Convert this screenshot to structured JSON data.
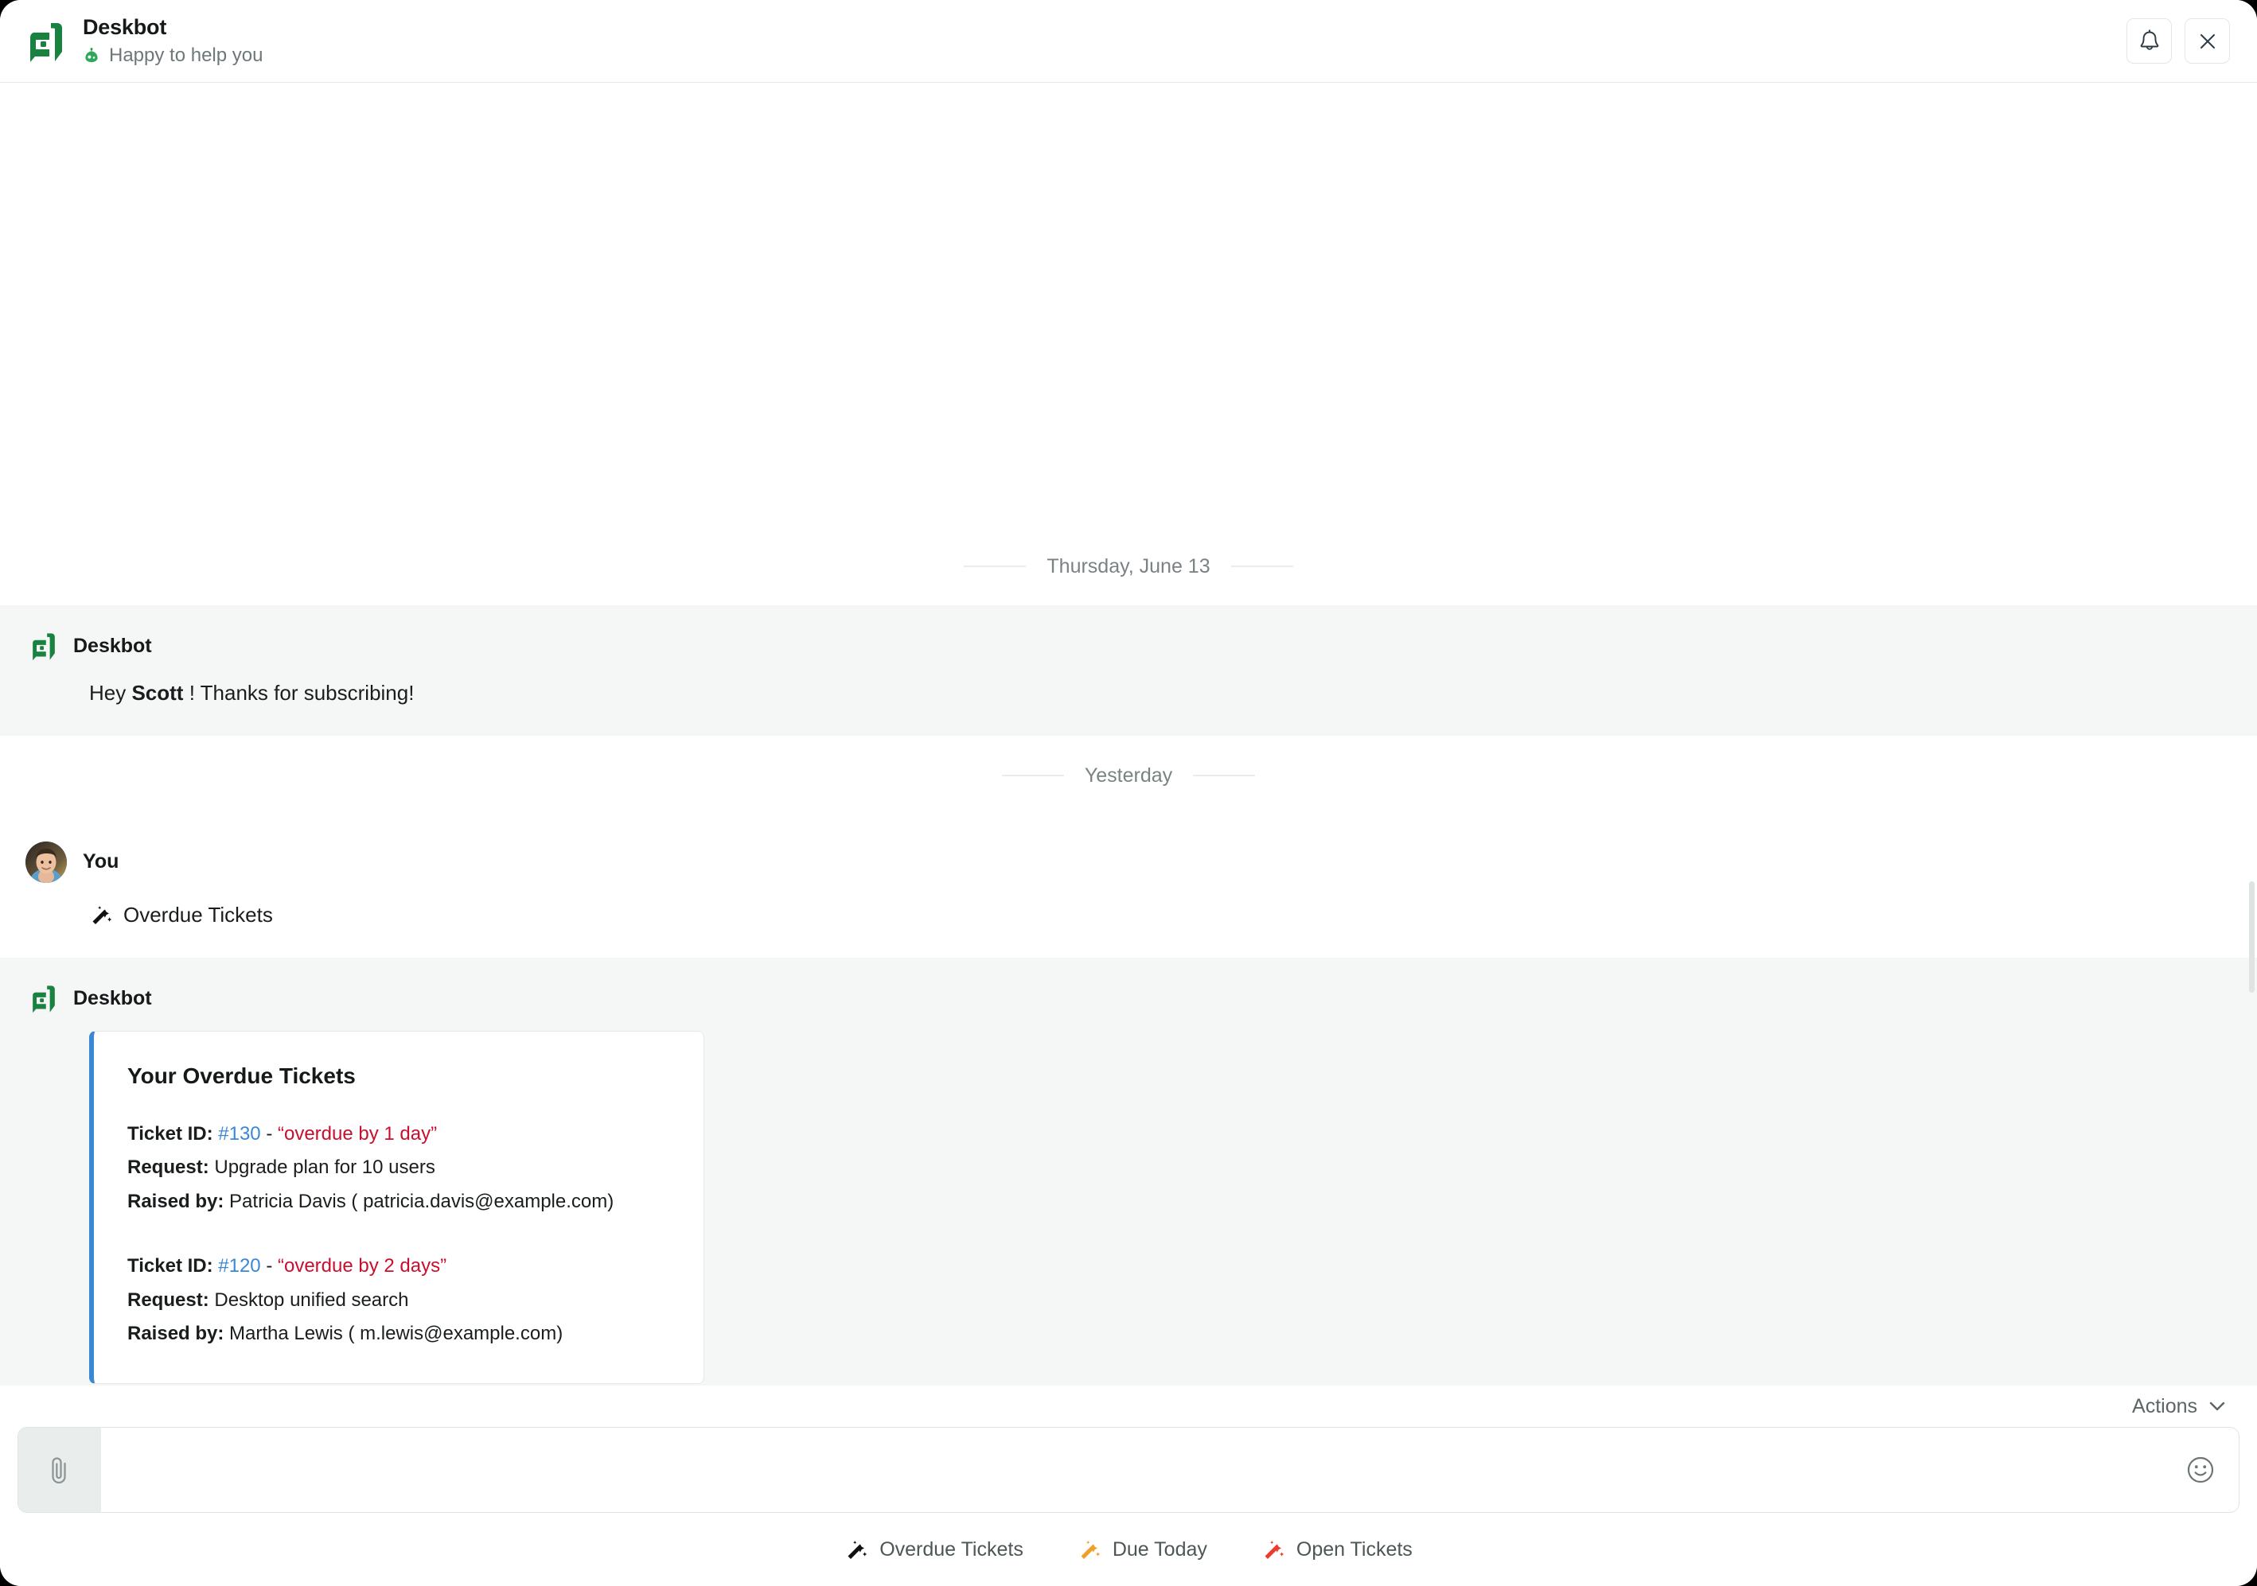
{
  "header": {
    "title": "Deskbot",
    "status": "Happy to help you",
    "logo_icon": "deskbot-logo-icon",
    "status_icon": "bot-avatar-icon",
    "notifications_label": "Notifications",
    "notifications_icon": "bell-icon",
    "close_label": "Close",
    "close_icon": "close-icon",
    "brand_color": "#1a8240"
  },
  "conversation": {
    "dividers": {
      "first": "Thursday, June 13",
      "second": "Yesterday"
    },
    "messages": [
      {
        "author": "Deskbot",
        "type": "bot",
        "text_prefix": "Hey ",
        "text_bold": "Scott",
        "text_suffix": " ! Thanks for subscribing!"
      },
      {
        "author": "You",
        "type": "user",
        "icon": "magic-wand-icon",
        "text": "Overdue Tickets"
      },
      {
        "author": "Deskbot",
        "type": "bot"
      }
    ],
    "card": {
      "title": "Your Overdue Tickets",
      "accent_color": "#3a87d4",
      "labels": {
        "ticket_id": "Ticket ID:",
        "request": "Request:",
        "raised_by": "Raised by:"
      },
      "tickets": [
        {
          "id": "#130",
          "separator": " - ",
          "status": "“overdue by 1 day”",
          "request": "Upgrade plan for 10 users",
          "raised_by": "Patricia Davis ( patricia.davis@example.com)"
        },
        {
          "id": "#120",
          "separator": " - ",
          "status": "“overdue by 2 days”",
          "request": "Desktop unified search",
          "raised_by": "Martha Lewis ( m.lewis@example.com)"
        }
      ],
      "id_color": "#3a87d4",
      "status_color": "#c8102e"
    }
  },
  "actions": {
    "label": "Actions",
    "chevron_icon": "chevron-down-icon"
  },
  "composer": {
    "attach_icon": "paperclip-icon",
    "emoji_icon": "smiley-icon",
    "value": "",
    "placeholder": ""
  },
  "quick_replies": [
    {
      "label": "Overdue Tickets",
      "icon": "magic-wand-icon",
      "color": "#111111"
    },
    {
      "label": "Due Today",
      "icon": "magic-wand-icon",
      "color": "#f0a028"
    },
    {
      "label": "Open Tickets",
      "icon": "magic-wand-icon",
      "color": "#ea3d2f"
    }
  ]
}
